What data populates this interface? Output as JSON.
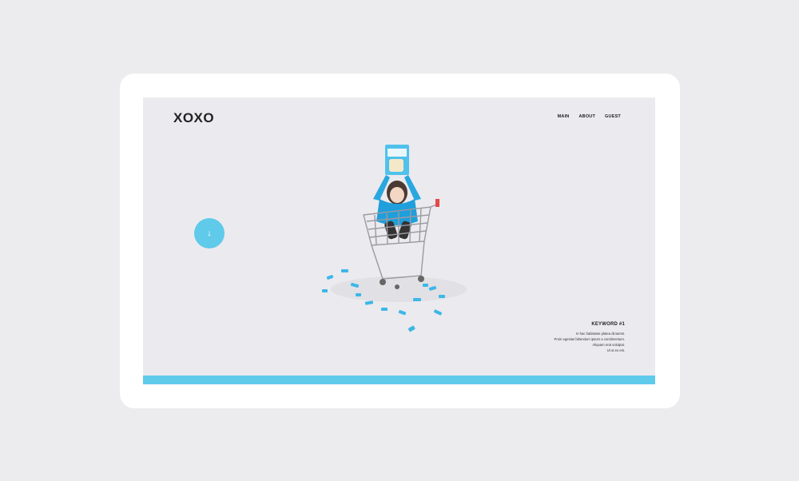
{
  "header": {
    "logo": "XOXO",
    "nav": [
      {
        "label": "MAIN"
      },
      {
        "label": "ABOUT"
      },
      {
        "label": "GUEST"
      }
    ]
  },
  "scroll_button": {
    "icon": "arrow-down-icon",
    "glyph": "↓"
  },
  "hero": {
    "image": "girl-in-shopping-cart-with-snacks"
  },
  "keyword": {
    "title": "KEYWORD #1",
    "lines": [
      "In hac habitasse platea dictumst.",
      "Proin egestas bibendum ipsum a condimentum.",
      "Aliquam erat volutpat.",
      "Ut ut ex est."
    ]
  },
  "colors": {
    "accent": "#5fcaea",
    "screen_bg": "#ebeaee",
    "page_bg": "#ececee",
    "text": "#222222"
  }
}
